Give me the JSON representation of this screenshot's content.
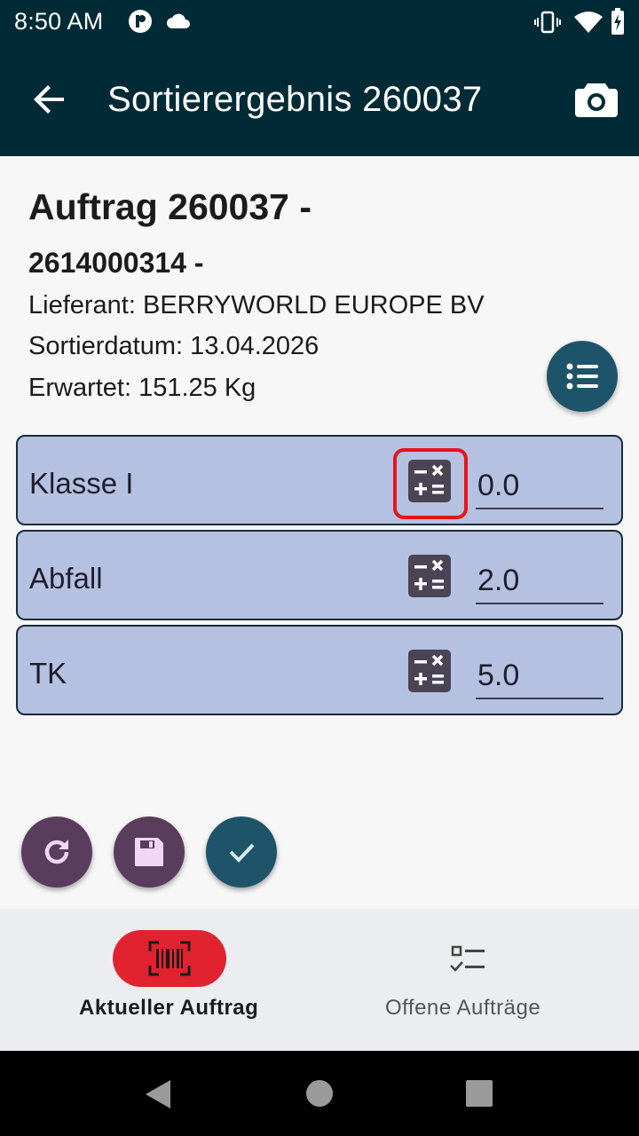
{
  "status_bar": {
    "time": "8:50 AM"
  },
  "app_bar": {
    "title": "Sortierergebnis 260037"
  },
  "header": {
    "order": "Auftrag 260037 -",
    "number": "2614000314 -",
    "supplier": "Lieferant: BERRYWORLD EUROPE BV",
    "sort_date": "Sortierdatum: 13.04.2026",
    "expected": "Erwartet: 151.25 Kg"
  },
  "rows": [
    {
      "label": "Klasse I",
      "value": "0.0"
    },
    {
      "label": "Abfall",
      "value": "2.0"
    },
    {
      "label": "TK",
      "value": "5.0"
    }
  ],
  "bottom_nav": {
    "current": "Aktueller Auftrag",
    "open": "Offene Aufträge"
  },
  "colors": {
    "app_bar": "#002b36",
    "card_bg": "#b5c1e0",
    "accent_red": "#e12330",
    "highlight": "#e8141c",
    "purple_button": "#5a3d5c",
    "teal_button": "#1e5469"
  },
  "icons": [
    "back-arrow-icon",
    "camera-icon",
    "list-icon",
    "calculator-icon",
    "refresh-icon",
    "save-icon",
    "check-icon",
    "barcode-icon",
    "checklist-icon"
  ]
}
